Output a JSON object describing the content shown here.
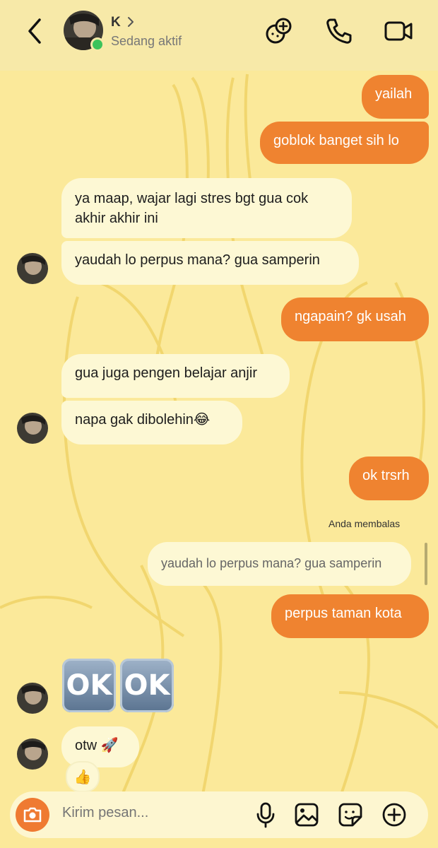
{
  "header": {
    "name": "K",
    "status": "Sedang aktif"
  },
  "messages": {
    "m1": "yailah",
    "m2": "goblok banget sih lo",
    "m3": "ya maap, wajar lagi stres bgt gua cok akhir akhir ini",
    "m4": "yaudah lo perpus mana? gua samperin",
    "m5": "ngapain? gk usah",
    "m6": "gua juga pengen belajar anjir",
    "m7": "napa gak dibolehin😂",
    "m8": "ok trsrh",
    "reply_label": "Anda membalas",
    "reply_quote": "yaudah lo perpus mana? gua samperin",
    "m9": "perpus taman kota",
    "m10_emoji": "OK",
    "m11": "otw 🚀",
    "reaction": "👍"
  },
  "composer": {
    "placeholder": "Kirim pesan..."
  },
  "colors": {
    "background": "#fbe99a",
    "outgoing_bubble": "#ef8330",
    "incoming_bubble": "#fdf8d4",
    "online": "#3cc35b"
  },
  "icons": [
    "back-arrow-icon",
    "chevron-right-icon",
    "effects-icon",
    "phone-icon",
    "video-camera-icon",
    "camera-icon",
    "microphone-icon",
    "gallery-icon",
    "sticker-icon",
    "plus-circle-icon",
    "thumbs-up-icon",
    "rocket-icon"
  ]
}
